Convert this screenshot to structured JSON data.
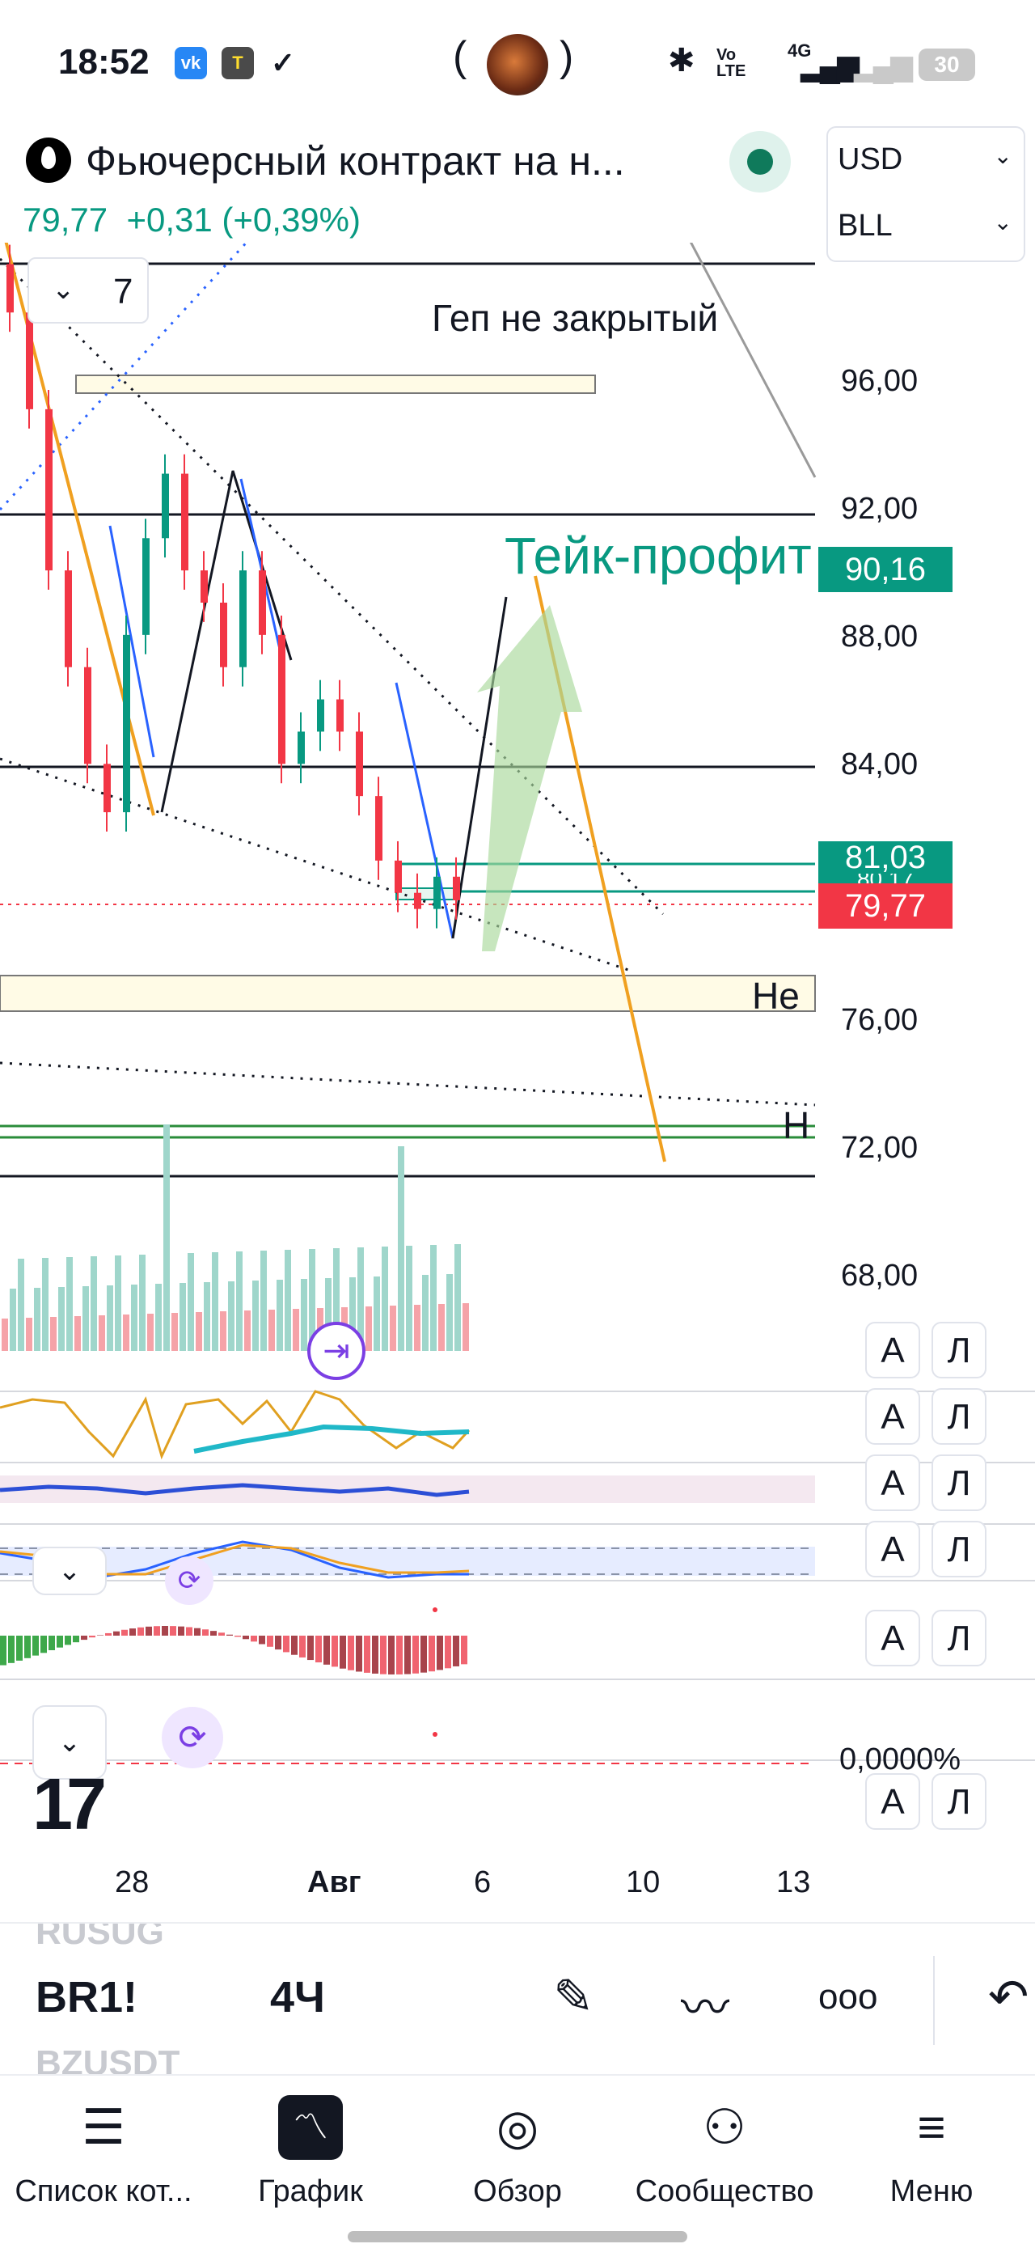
{
  "status_bar": {
    "time": "18:52",
    "apps": [
      "vk-icon",
      "tinkoff-icon",
      "check-icon"
    ],
    "camera_left": "(",
    "camera_right": ")",
    "signal": "Vo LTE",
    "network": "4G",
    "battery": "30"
  },
  "instrument": {
    "title": "Фьючерсный контракт на н...",
    "price": "79,77",
    "change": "+0,31",
    "change_pct": "(+0,39%)"
  },
  "currency_select": {
    "currency": "USD",
    "unit": "BLL"
  },
  "chart": {
    "interval_count": "7",
    "annotations": {
      "gap": "Геп не закрытый",
      "take_profit": "Тейк-профит",
      "he_label": "Не",
      "h_label": "Н"
    },
    "price_axis": [
      "96,00",
      "92,00",
      "88,00",
      "84,00",
      "76,00",
      "72,00",
      "68,00"
    ],
    "price_tags": [
      {
        "value": "90,16",
        "color": "#089981"
      },
      {
        "value": "81,03",
        "color": "#089981"
      },
      {
        "value": "80,17",
        "color": "#089981"
      },
      {
        "value": "79,77",
        "color": "#f23645"
      }
    ],
    "date_axis": [
      {
        "label": "28",
        "bold": false
      },
      {
        "label": "Авг",
        "bold": true
      },
      {
        "label": "6",
        "bold": false
      },
      {
        "label": "10",
        "bold": false
      },
      {
        "label": "13",
        "bold": false
      }
    ],
    "pane_buttons": {
      "a": "А",
      "l": "Л"
    },
    "percent_label": "0,0000%",
    "logo": "17"
  },
  "chart_data": {
    "type": "candlestick",
    "xlabel": "",
    "ylabel": "",
    "yticks": [
      96,
      92,
      88,
      84,
      76,
      72,
      68
    ],
    "x_ticks": [
      "28",
      "Авг",
      "6",
      "10",
      "13"
    ],
    "last_price": 79.77,
    "horizontal_levels": [
      92,
      84,
      73
    ],
    "closes_approx": [
      98,
      95,
      90,
      87,
      84,
      82.5,
      88,
      91,
      93,
      90,
      89,
      87,
      90,
      88,
      84,
      85,
      86,
      85,
      83,
      81,
      80,
      79.5,
      80.5,
      79.77
    ],
    "labels": {
      "take_profit": "Тейк-профит",
      "gap": "Геп не закрытый"
    }
  },
  "toolbar": {
    "symbol_prev": "RUSUG",
    "symbol": "BR1!",
    "symbol_next": "BZUSDT",
    "timeframe": "4Ч",
    "icons": [
      "pencil-icon",
      "indicators-icon",
      "more-icon",
      "undo-icon"
    ]
  },
  "nav": [
    {
      "label": "Список кот...",
      "icon": "watchlist-icon"
    },
    {
      "label": "График",
      "icon": "chart-icon"
    },
    {
      "label": "Обзор",
      "icon": "compass-icon"
    },
    {
      "label": "Сообщество",
      "icon": "community-icon"
    },
    {
      "label": "Меню",
      "icon": "menu-icon"
    }
  ]
}
